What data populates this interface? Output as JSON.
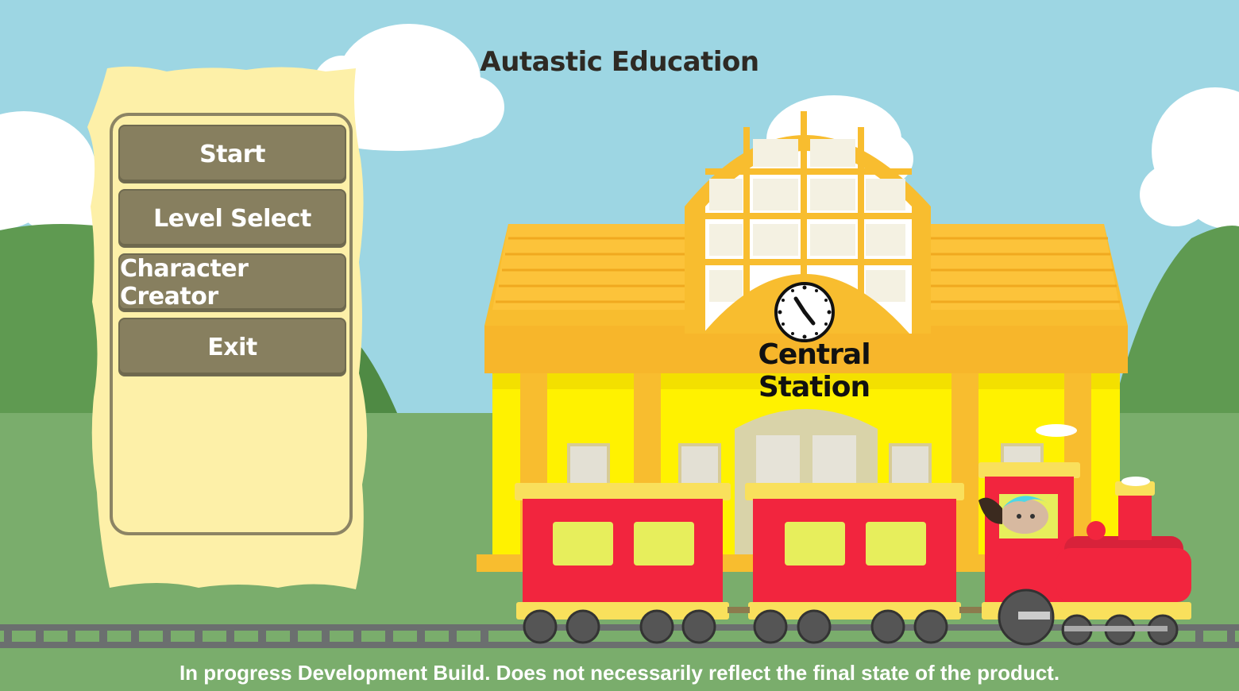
{
  "app": {
    "title": "Autastic Education"
  },
  "menu": {
    "items": [
      {
        "label": "Start"
      },
      {
        "label": "Level Select"
      },
      {
        "label": "Character Creator"
      },
      {
        "label": "Exit"
      }
    ]
  },
  "scene": {
    "station_sign": "Central Station"
  },
  "footer": {
    "notice": "In progress Development Build. Does not necessarily reflect the final state of the product."
  },
  "colors": {
    "sky": "#9dd6e3",
    "grass": "#7aad6c",
    "menu_button": "#877f5f",
    "scroll": "#fdf0a8",
    "station_roof": "#f8bd2f",
    "station_wall": "#fff200",
    "train_red": "#f2253e"
  }
}
